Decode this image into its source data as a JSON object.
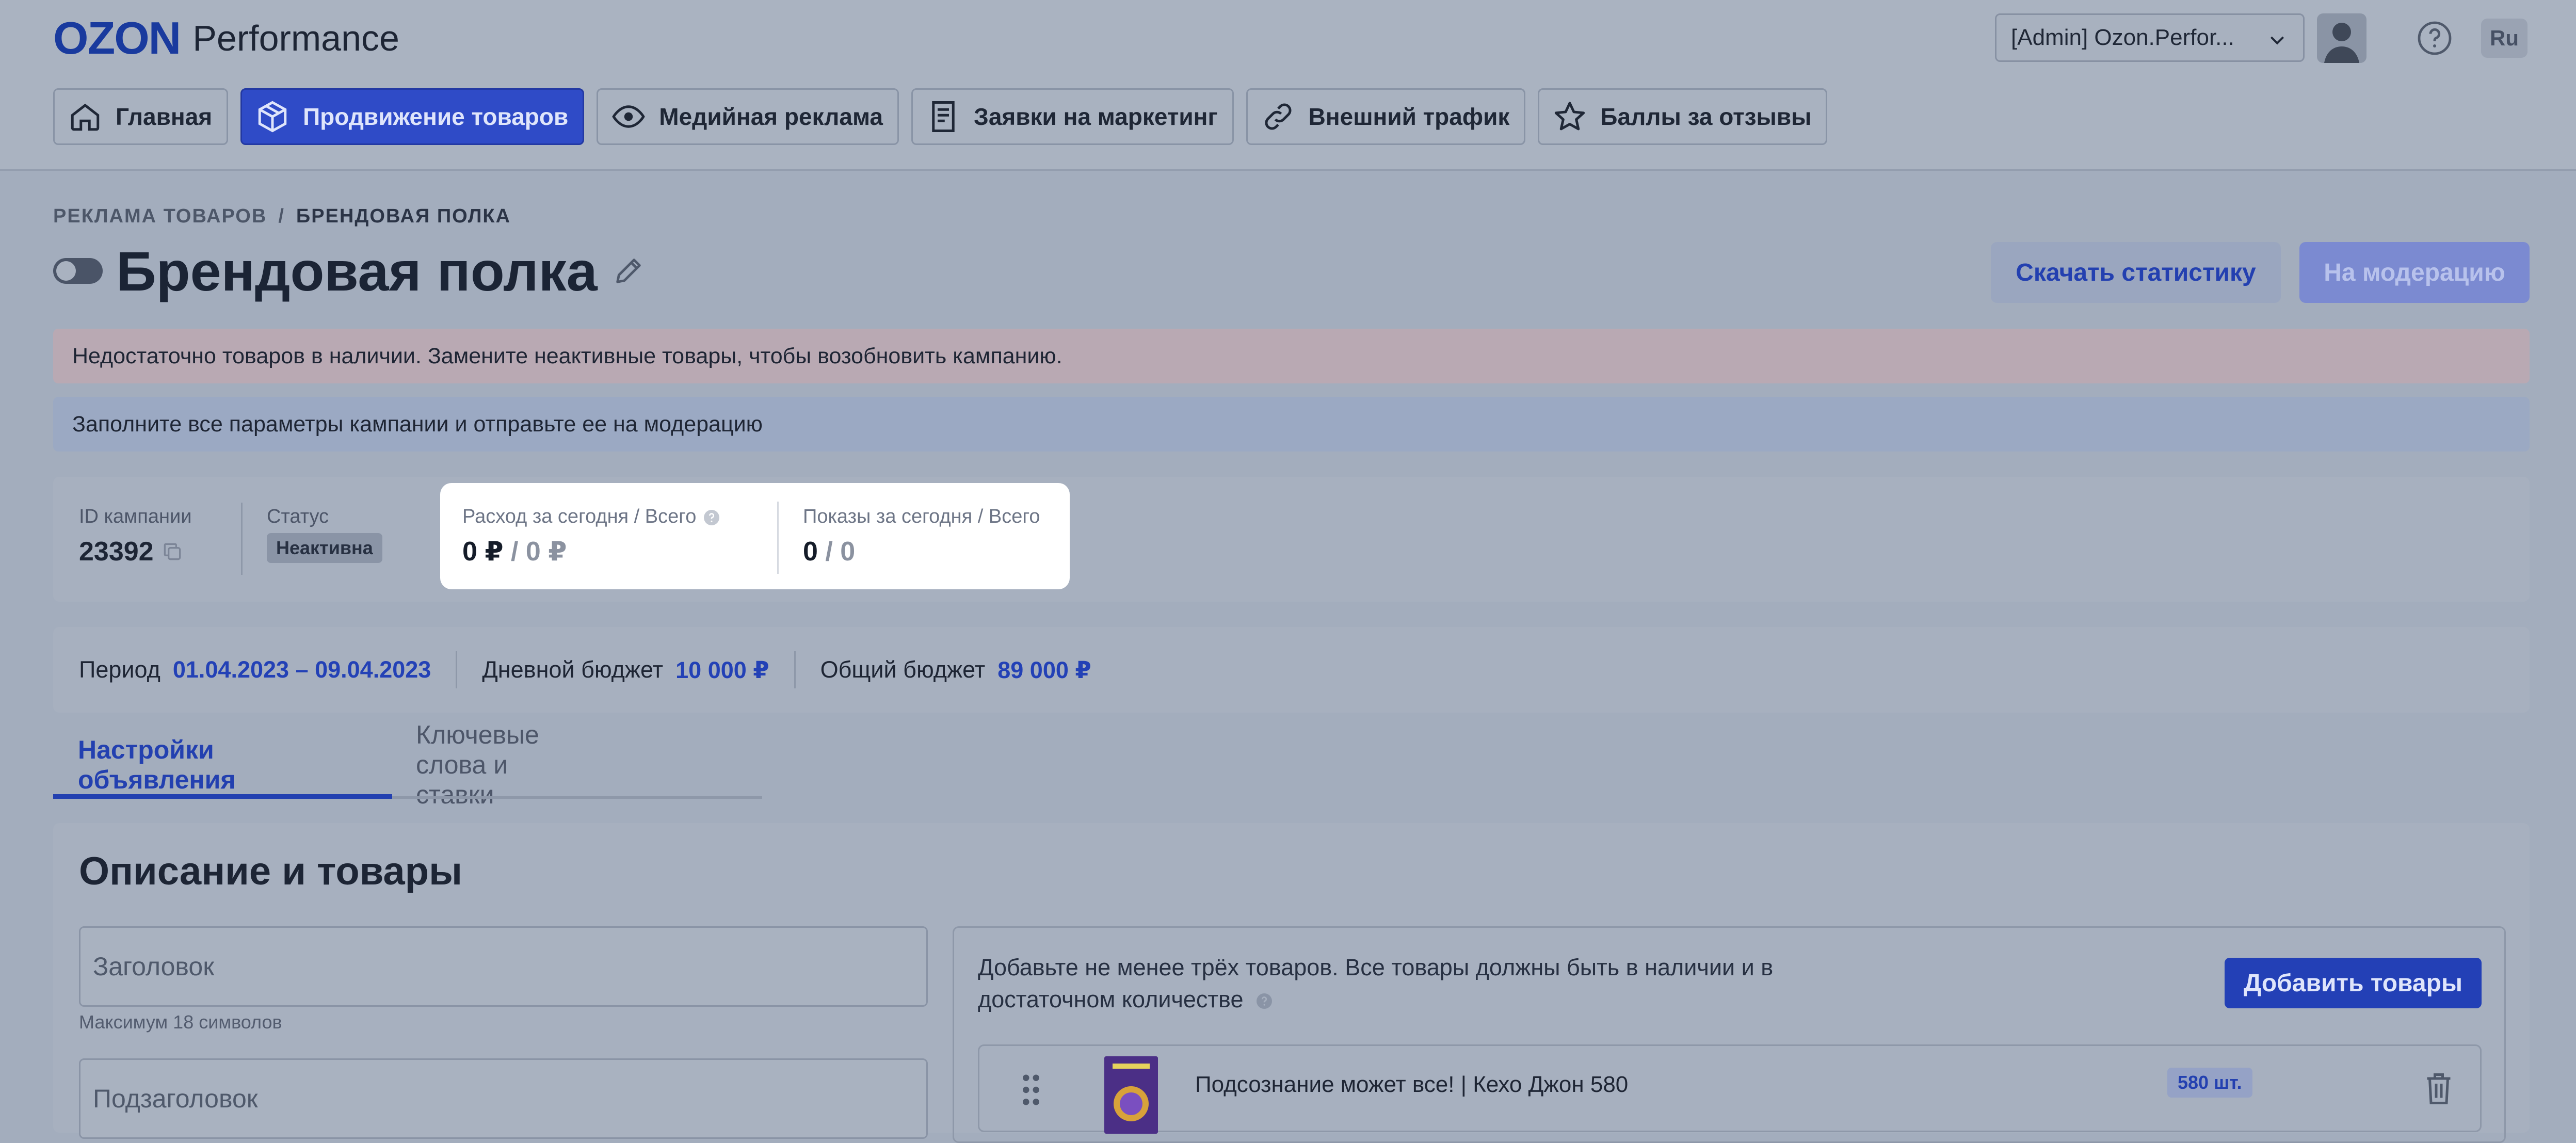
{
  "header": {
    "logo_brand": "OZON",
    "logo_product": "Performance",
    "account_select": "[Admin] Ozon.Perfor...",
    "lang": "Ru"
  },
  "nav": [
    {
      "label": "Главная",
      "icon": "home-icon"
    },
    {
      "label": "Продвижение товаров",
      "icon": "box-icon",
      "active": true
    },
    {
      "label": "Медийная реклама",
      "icon": "eye-icon"
    },
    {
      "label": "Заявки на маркетинг",
      "icon": "document-icon"
    },
    {
      "label": "Внешний трафик",
      "icon": "link-icon"
    },
    {
      "label": "Баллы за отзывы",
      "icon": "star-icon"
    }
  ],
  "breadcrumb": {
    "parent": "РЕКЛАМА ТОВАРОВ",
    "separator": "/",
    "current": "БРЕНДОВАЯ ПОЛКА"
  },
  "page": {
    "title": "Брендовая полка",
    "download_button": "Скачать статистику",
    "moderation_button": "На модерацию"
  },
  "alerts": {
    "error": "Недостаточно товаров в наличии. Замените неактивные товары, чтобы возобновить кампанию.",
    "info": "Заполните все параметры кампании и отправьте ее на модерацию"
  },
  "stats": {
    "campaign_id_label": "ID кампании",
    "campaign_id": "23392",
    "status_label": "Статус",
    "status": "Неактивна",
    "spend_label": "Расход за сегодня / Всего",
    "spend_today": "0 ₽",
    "spend_sep": "/",
    "spend_total": "0 ₽",
    "impressions_label": "Показы за сегодня / Всего",
    "impressions_today": "0",
    "impressions_sep": "/",
    "impressions_total": "0"
  },
  "budget": {
    "period_label": "Период",
    "period_value": "01.04.2023 – 09.04.2023",
    "daily_label": "Дневной бюджет",
    "daily_value": "10 000 ₽",
    "total_label": "Общий бюджет",
    "total_value": "89 000 ₽"
  },
  "tabs": [
    {
      "label": "Настройки объявления",
      "active": true
    },
    {
      "label": "Ключевые слова и ставки",
      "active": false
    }
  ],
  "section": {
    "title": "Описание и товары",
    "headline_placeholder": "Заголовок",
    "headline_hint": "Максимум 18 символов",
    "subheadline_placeholder": "Подзаголовок",
    "products_hint": "Добавьте не менее трёх товаров. Все товары должны быть в наличии и в достаточном количестве",
    "add_products_button": "Добавить товары",
    "product": {
      "name": "Подсознание может все! | Кехо Джон 580",
      "qty": "580 шт."
    }
  },
  "colors": {
    "accent": "#2340b6",
    "overlay": "#a3adbd",
    "highlight": "#ffffff"
  }
}
